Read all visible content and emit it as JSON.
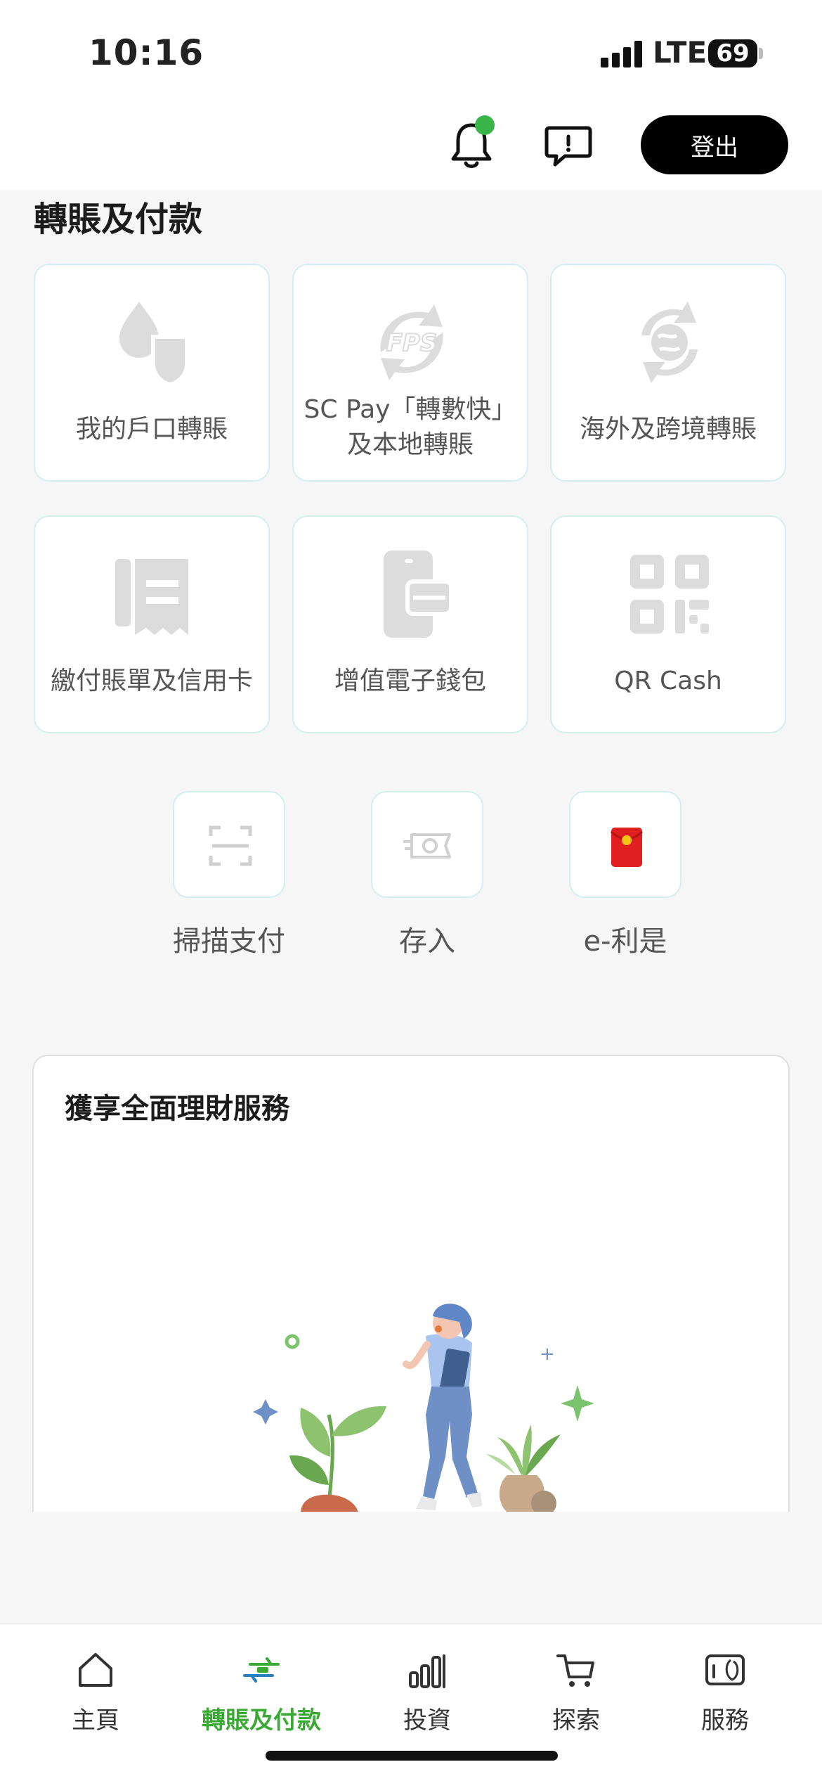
{
  "status_bar": {
    "time": "10:16",
    "network": "LTE",
    "battery": "69"
  },
  "header": {
    "logout_label": "登出",
    "notification_dot_color": "#39b54a"
  },
  "section": {
    "title": "轉賬及付款"
  },
  "cards": [
    {
      "label": "我的戶口轉賬",
      "icon": "drop-shield-icon"
    },
    {
      "label_line1": "SC Pay「轉數快」",
      "label_line2": "及本地轉賬",
      "icon": "fps-icon"
    },
    {
      "label": "海外及跨境轉賬",
      "icon": "global-transfer-icon"
    },
    {
      "label": "繳付賬單及信用卡",
      "icon": "bill-icon"
    },
    {
      "label": "增值電子錢包",
      "icon": "e-wallet-icon"
    },
    {
      "label": "QR Cash",
      "icon": "qr-code-icon"
    }
  ],
  "quick_actions": [
    {
      "label": "掃描支付",
      "icon": "scan-icon"
    },
    {
      "label": "存入",
      "icon": "deposit-cash-icon"
    },
    {
      "label": "e-利是",
      "icon": "red-packet-icon"
    }
  ],
  "promo": {
    "title": "獲享全面理財服務"
  },
  "bottom_nav": [
    {
      "label": "主頁",
      "icon": "home-icon",
      "active": false
    },
    {
      "label": "轉賬及付款",
      "icon": "transfer-icon",
      "active": true
    },
    {
      "label": "投資",
      "icon": "chart-bars-icon",
      "active": false
    },
    {
      "label": "探索",
      "icon": "cart-icon",
      "active": false
    },
    {
      "label": "服務",
      "icon": "service-icon",
      "active": false
    }
  ],
  "colors": {
    "accent_green": "#3aaa35",
    "icon_gray": "#d9d9d9",
    "red_packet": "#e02020"
  }
}
